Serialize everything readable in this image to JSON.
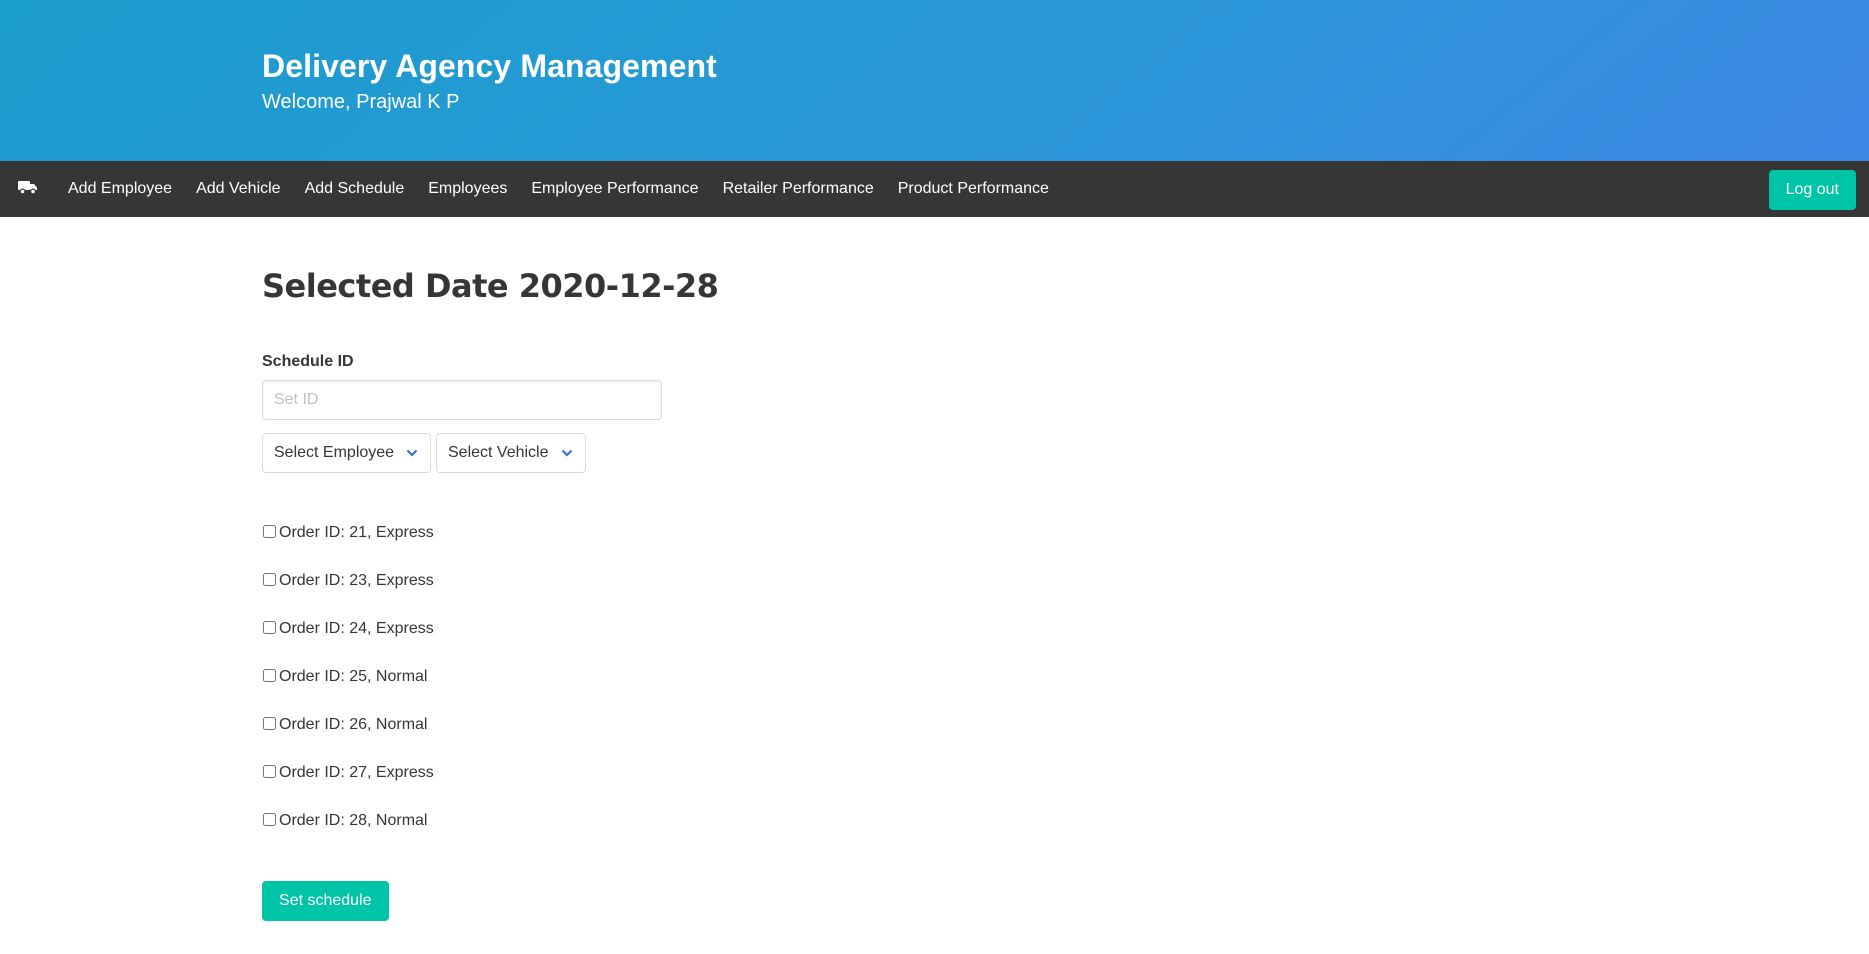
{
  "header": {
    "title": "Delivery Agency Management",
    "welcome": "Welcome, Prajwal K P"
  },
  "navbar": {
    "brand_icon": "truck-icon",
    "items": [
      {
        "label": "Add Employee"
      },
      {
        "label": "Add Vehicle"
      },
      {
        "label": "Add Schedule"
      },
      {
        "label": "Employees"
      },
      {
        "label": "Employee Performance"
      },
      {
        "label": "Retailer Performance"
      },
      {
        "label": "Product Performance"
      }
    ],
    "logout_label": "Log out"
  },
  "form": {
    "title": "Selected Date 2020-12-28",
    "schedule_id_label": "Schedule ID",
    "schedule_id_placeholder": "Set ID",
    "schedule_id_value": "",
    "employee_select": "Select Employee",
    "vehicle_select": "Select Vehicle",
    "orders": [
      {
        "label": "Order ID: 21, Express",
        "checked": false
      },
      {
        "label": "Order ID: 23, Express",
        "checked": false
      },
      {
        "label": "Order ID: 24, Express",
        "checked": false
      },
      {
        "label": "Order ID: 25, Normal",
        "checked": false
      },
      {
        "label": "Order ID: 26, Normal",
        "checked": false
      },
      {
        "label": "Order ID: 27, Express",
        "checked": false
      },
      {
        "label": "Order ID: 28, Normal",
        "checked": false
      }
    ],
    "submit_label": "Set schedule"
  },
  "colors": {
    "hero_start": "#1a9ccc",
    "hero_end": "#3d86e4",
    "navbar": "#363636",
    "primary_button": "#00c4a7",
    "select_arrow": "#3273dc"
  }
}
